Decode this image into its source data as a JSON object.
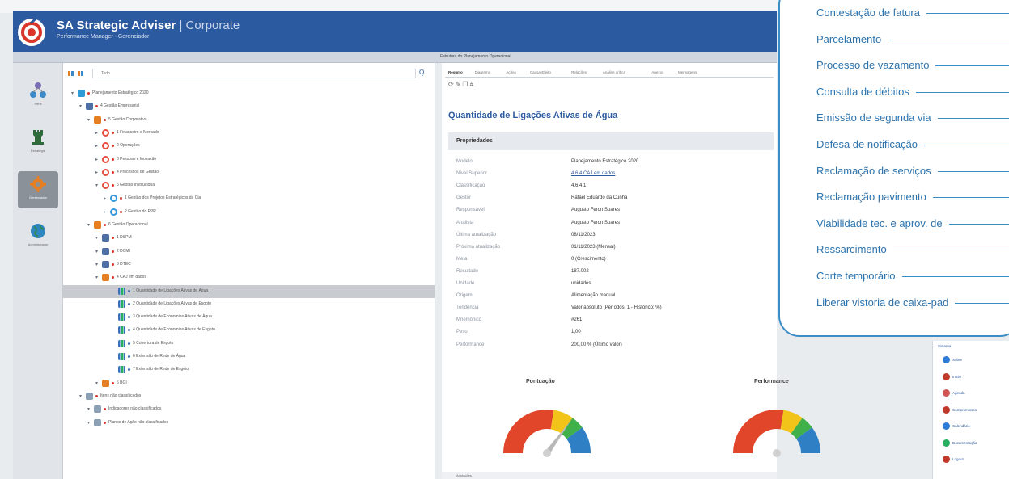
{
  "app": {
    "name": "SA Strategic Adviser",
    "separator": "|",
    "edition": "Corporate",
    "subtitle": "Performance Manager - Gerenciador",
    "structure_title": "Estrutura do Planejamento Operacional"
  },
  "rail": [
    {
      "name": "Perfil",
      "icon": "org-chart-icon",
      "active": false
    },
    {
      "name": "Estratégia",
      "icon": "chess-tower-icon",
      "active": false
    },
    {
      "name": "Gerenciador",
      "icon": "gear-icon",
      "active": true
    },
    {
      "name": "Administrador",
      "icon": "globe-icon",
      "active": false
    }
  ],
  "tree": {
    "filter_label": "Todo",
    "nodes": [
      {
        "level": 0,
        "text": "Planejamento Estratégico 2020",
        "icon": "plan",
        "color": "#2e9bd6"
      },
      {
        "level": 1,
        "text": "4 Gestão Empresarial",
        "icon": "group",
        "color": "#4d6fa5"
      },
      {
        "level": 2,
        "text": "5 Gestão Corporativa",
        "icon": "folder",
        "color": "#e67e22"
      },
      {
        "level": 3,
        "text": "1 Financeiro e Mercado",
        "icon": "target",
        "color": "#e74c3c"
      },
      {
        "level": 3,
        "text": "2 Operações",
        "icon": "target",
        "color": "#e74c3c"
      },
      {
        "level": 3,
        "text": "3 Pessoas e Inovação",
        "icon": "target",
        "color": "#e74c3c"
      },
      {
        "level": 3,
        "text": "4 Processos de Gestão",
        "icon": "target",
        "color": "#e74c3c"
      },
      {
        "level": 3,
        "text": "5 Gestão Institucional",
        "icon": "target",
        "color": "#e74c3c"
      },
      {
        "level": 4,
        "text": "1 Gestão dos Projetos Estratégicos da Cia",
        "icon": "target",
        "color": "#3498db"
      },
      {
        "level": 4,
        "text": "2 Gestão do PPR",
        "icon": "target",
        "color": "#3498db"
      },
      {
        "level": 2,
        "text": "6 Gestão Operacional",
        "icon": "folder",
        "color": "#e67e22"
      },
      {
        "level": 3,
        "text": "1 DSPM",
        "icon": "group",
        "color": "#4d6fa5"
      },
      {
        "level": 3,
        "text": "2 DCMI",
        "icon": "group",
        "color": "#4d6fa5"
      },
      {
        "level": 3,
        "text": "3 DTEC",
        "icon": "group",
        "color": "#4d6fa5"
      },
      {
        "level": 3,
        "text": "4 CAJ em dados",
        "icon": "folder",
        "color": "#e67e22"
      },
      {
        "level": 5,
        "text": "1 Quantidade de Ligações Ativas de Água",
        "icon": "bars",
        "color": "#3a6fbf",
        "selected": true
      },
      {
        "level": 5,
        "text": "2 Quantidade de Ligações Ativas de Esgoto",
        "icon": "bars",
        "color": "#3a6fbf"
      },
      {
        "level": 5,
        "text": "3 Quantidade de Economias Ativas de Água",
        "icon": "bars",
        "color": "#3a6fbf"
      },
      {
        "level": 5,
        "text": "4 Quantidade de Economias Ativas de Esgoto",
        "icon": "bars",
        "color": "#3a6fbf"
      },
      {
        "level": 5,
        "text": "5 Cobertura de Esgoto",
        "icon": "bars",
        "color": "#3a6fbf"
      },
      {
        "level": 5,
        "text": "6 Extensão de Rede de Água",
        "icon": "bars",
        "color": "#3a6fbf"
      },
      {
        "level": 5,
        "text": "7 Extensão de Rede de Esgoto",
        "icon": "bars",
        "color": "#3a6fbf"
      },
      {
        "level": 3,
        "text": "5 BGI",
        "icon": "folder",
        "color": "#e67e22"
      },
      {
        "level": 1,
        "text": "Itens não classificados",
        "icon": "box",
        "color": "#8ca0b5"
      },
      {
        "level": 2,
        "text": "Indicadores não classificados",
        "icon": "box",
        "color": "#8ca0b5"
      },
      {
        "level": 2,
        "text": "Planos de Ação não classificados",
        "icon": "box",
        "color": "#8ca0b5"
      }
    ]
  },
  "details": {
    "tabs": [
      "Resumo",
      "Diagrama",
      "Ações",
      "Causa-Efeito",
      "Relações",
      "Análise crítica",
      "Anexos",
      "Mensagens"
    ],
    "active_tab": "Resumo",
    "indicator_title": "Quantidade de Ligações Ativas de Água",
    "properties_label": "Propriedades",
    "properties": [
      {
        "key": "Modelo",
        "value": "Planejamento Estratégico 2020",
        "link": false
      },
      {
        "key": "Nível Superior",
        "value": "4.6.4 CAJ em dados",
        "link": true
      },
      {
        "key": "Classificação",
        "value": "4.6.4.1",
        "link": false
      },
      {
        "key": "Gestor",
        "value": "Rafael Eduardo da Cunha",
        "link": false
      },
      {
        "key": "Responsável",
        "value": "Augusto Feron Soares",
        "link": false
      },
      {
        "key": "Analista",
        "value": "Augusto Feron Soares",
        "link": false
      },
      {
        "key": "Última atualização",
        "value": "08/11/2023",
        "link": false
      },
      {
        "key": "Próxima atualização",
        "value": "01/11/2023 (Mensal)",
        "link": false
      },
      {
        "key": "Meta",
        "value": "0 (Crescimento)",
        "link": false
      },
      {
        "key": "Resultado",
        "value": "187.002",
        "link": false
      },
      {
        "key": "Unidade",
        "value": "unidades",
        "link": false
      },
      {
        "key": "Origem",
        "value": "Alimentação manual",
        "link": false
      },
      {
        "key": "Tendência",
        "value": "Valor absoluto (Períodos: 1 - Histórico: %)",
        "link": false
      },
      {
        "key": "Mnemônico",
        "value": "#261",
        "link": false
      },
      {
        "key": "Peso",
        "value": "1,00",
        "link": false
      },
      {
        "key": "Performance",
        "value": "200,00 % (Último valor)",
        "link": false
      }
    ],
    "gauges": [
      {
        "title": "Pontuação",
        "value_fraction": 0.7
      },
      {
        "title": "Performance",
        "value_fraction": 1.0
      }
    ],
    "bottom_label": "Anotações"
  },
  "callout_items": [
    "Contestação de fatura",
    "Parcelamento",
    "Processo de vazamento",
    "Consulta de débitos",
    "Emissão de segunda via",
    "Defesa de notificação",
    "Reclamação de serviços",
    "Reclamação pavimento",
    "Viabilidade tec. e aprov. de",
    "Ressarcimento",
    "Corte temporário",
    "Liberar vistoria de caixa-pad"
  ],
  "minibar": {
    "head": "Sistema",
    "items": [
      {
        "label": "Sobre",
        "icon": "info-icon",
        "color": "#2c7bd6"
      },
      {
        "label": "Início",
        "icon": "home-icon",
        "color": "#c0392b"
      },
      {
        "label": "Agenda",
        "icon": "calendar-icon",
        "color": "#d35454"
      },
      {
        "label": "Compromissos",
        "icon": "briefcase-icon",
        "color": "#c0392b"
      },
      {
        "label": "Calendário",
        "icon": "calendar-icon",
        "color": "#2c7bd6"
      },
      {
        "label": "Documentação",
        "icon": "chart-icon",
        "color": "#27ae60"
      },
      {
        "label": "Logout",
        "icon": "logout-icon",
        "color": "#c0392b"
      }
    ]
  }
}
